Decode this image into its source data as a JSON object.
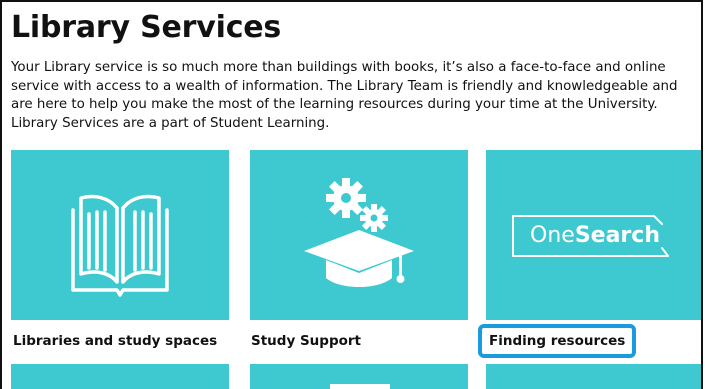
{
  "page": {
    "title": "Library Services",
    "intro": "Your Library service is so much more than buildings with books, it’s also a face-to-face and online service with access to a wealth of information. The Library Team is friendly and knowledgeable and are here to help you make the most of the learning resources during your time at the University. Library Services are a part of Student Learning."
  },
  "tiles": [
    {
      "label": "Libraries and study spaces",
      "icon": "open-book-icon"
    },
    {
      "label": "Study Support",
      "icon": "graduation-cap-gears-icon"
    },
    {
      "label": "Finding resources",
      "icon": "onesearch-logo",
      "logo_text_prefix": "One",
      "logo_text_bold": "Search"
    }
  ],
  "colors": {
    "tile": "#3ec8cf",
    "focus": "#1a9be0",
    "text": "#111111",
    "background": "#ffffff"
  }
}
